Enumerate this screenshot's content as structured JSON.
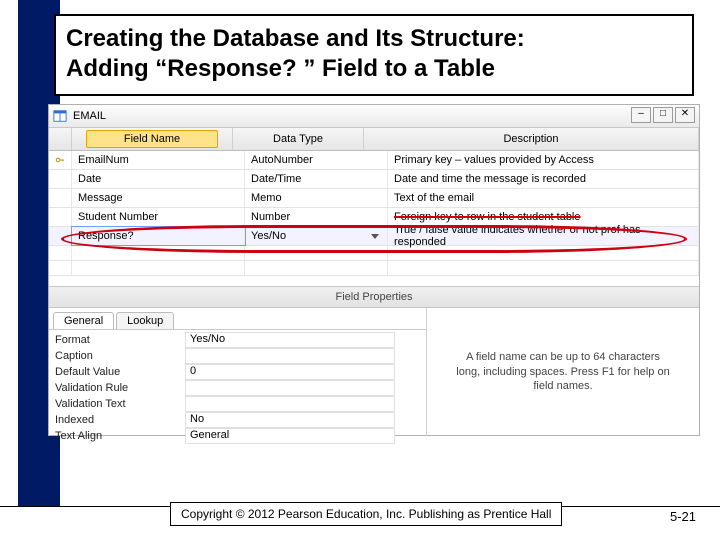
{
  "slide": {
    "title_line1": "Creating the Database and Its Structure:",
    "title_line2": "Adding “Response? ” Field to a Table",
    "copyright": "Copyright © 2012 Pearson Education, Inc. Publishing as Prentice Hall",
    "page_number": "5-21"
  },
  "window": {
    "title": "EMAIL",
    "columns": {
      "field_name": "Field Name",
      "data_type": "Data Type",
      "description": "Description"
    },
    "fields": [
      {
        "pk": true,
        "name": "EmailNum",
        "type": "AutoNumber",
        "desc": "Primary key – values provided by Access"
      },
      {
        "pk": false,
        "name": "Date",
        "type": "Date/Time",
        "desc": "Date and time the message is recorded"
      },
      {
        "pk": false,
        "name": "Message",
        "type": "Memo",
        "desc": "Text of the email"
      },
      {
        "pk": false,
        "name": "Student Number",
        "type": "Number",
        "desc": "Foreign key to row in the student table"
      },
      {
        "pk": false,
        "name": "Response?",
        "type": "Yes/No",
        "desc": "True / false value indicates whether or not prof has responded",
        "active": true
      }
    ],
    "field_properties_label": "Field Properties",
    "tabs": {
      "general": "General",
      "lookup": "Lookup"
    },
    "properties": [
      {
        "label": "Format",
        "value": "Yes/No"
      },
      {
        "label": "Caption",
        "value": ""
      },
      {
        "label": "Default Value",
        "value": "0"
      },
      {
        "label": "Validation Rule",
        "value": ""
      },
      {
        "label": "Validation Text",
        "value": ""
      },
      {
        "label": "Indexed",
        "value": "No"
      },
      {
        "label": "Text Align",
        "value": "General"
      }
    ],
    "help_text": "A field name can be up to 64 characters long, including spaces. Press F1 for help on field names."
  }
}
